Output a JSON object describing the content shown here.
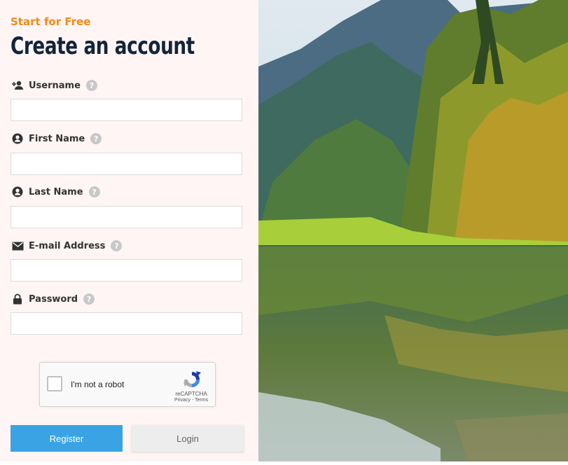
{
  "header": {
    "tagline": "Start for Free",
    "title": "Create an account"
  },
  "fields": [
    {
      "label": "Username",
      "icon": "add-user-icon",
      "value": "",
      "help": "?"
    },
    {
      "label": "First Name",
      "icon": "person-icon",
      "value": "",
      "help": "?"
    },
    {
      "label": "Last Name",
      "icon": "person-icon",
      "value": "",
      "help": "?"
    },
    {
      "label": "E-mail Address",
      "icon": "envelope-icon",
      "value": "",
      "help": "?"
    },
    {
      "label": "Password",
      "icon": "lock-icon",
      "value": "",
      "help": "?"
    }
  ],
  "captcha": {
    "label": "I'm not a robot",
    "brand": "reCAPTCHA",
    "links": "Privacy - Terms",
    "checked": false
  },
  "buttons": {
    "register": "Register",
    "login": "Login"
  },
  "colors": {
    "accent_orange": "#f08a1c",
    "title": "#13243a",
    "register_bg": "#3aa3e3",
    "panel_bg": "#fff5f5"
  }
}
